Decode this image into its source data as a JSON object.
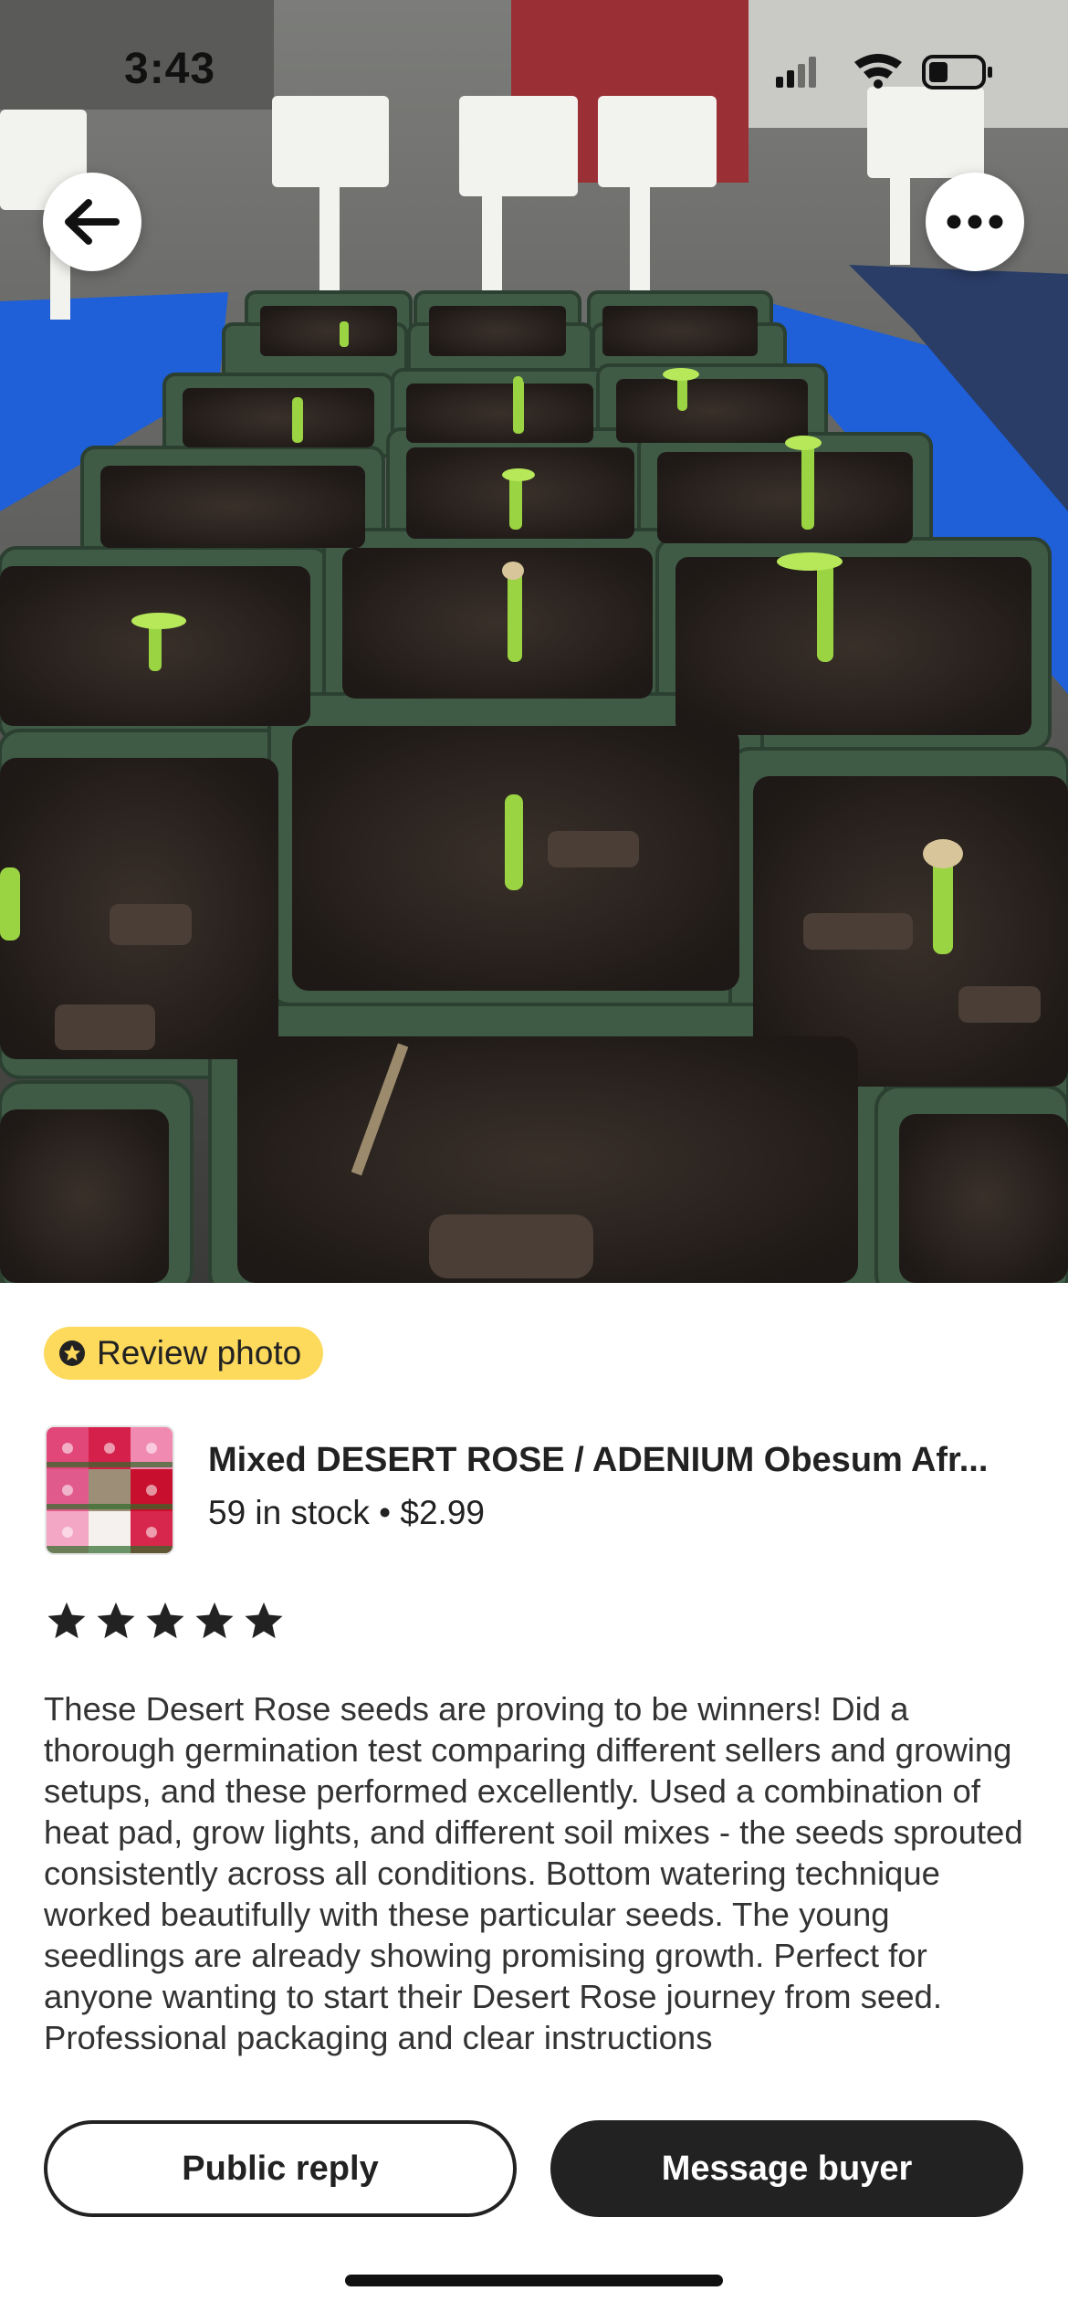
{
  "status_bar": {
    "time": "3:43"
  },
  "photo": {
    "description_icon_back": "arrow-left-icon",
    "description_icon_more": "ellipsis-icon"
  },
  "badge": {
    "label": "Review photo",
    "icon": "star-badge-icon"
  },
  "listing": {
    "title": "Mixed DESERT ROSE / ADENIUM Obesum Afr...",
    "stock_price": "59 in stock • $2.99"
  },
  "rating": {
    "stars": 5,
    "max": 5
  },
  "review": {
    "text": "These Desert Rose seeds are proving to be winners! Did a thorough germination test comparing different sellers and growing setups, and these performed excellently. Used a combination of heat pad, grow lights, and different soil mixes - the seeds sprouted consistently across all conditions. Bottom watering technique worked beautifully with these particular seeds. The young seedlings are already showing promising growth. Perfect for anyone wanting to start their Desert Rose journey from seed. Professional packaging and clear instructions"
  },
  "actions": {
    "public_reply": "Public reply",
    "message_buyer": "Message buyer"
  },
  "colors": {
    "badge_bg": "#fdd95c",
    "primary_dark": "#222222",
    "pot_green": "#3f5a45",
    "tray_blue": "#1f5fd8"
  }
}
